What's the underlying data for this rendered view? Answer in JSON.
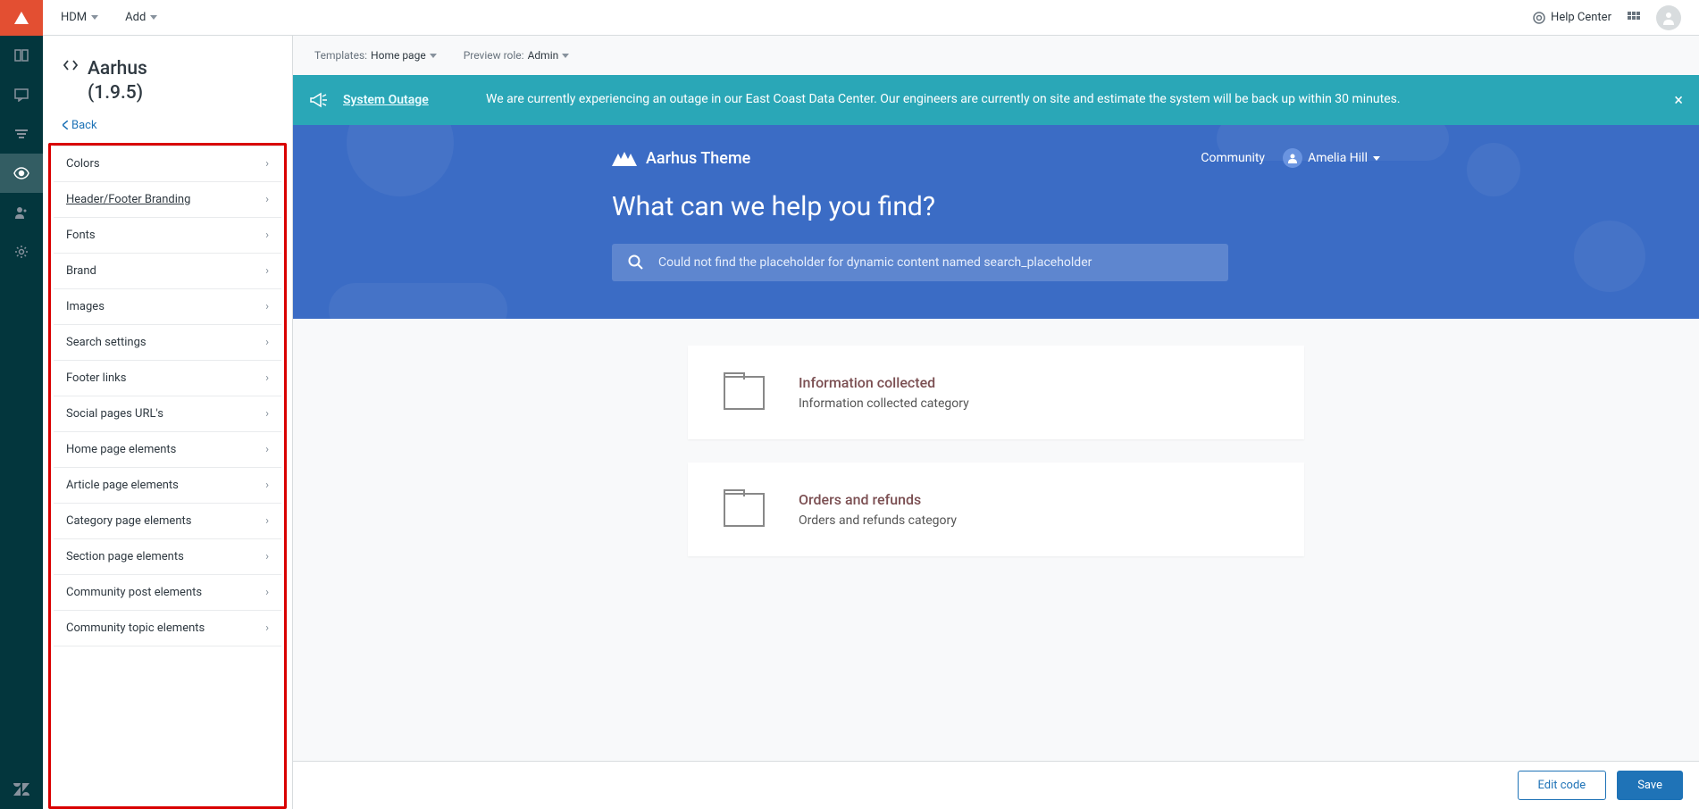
{
  "topbar": {
    "dropdowns": [
      "HDM",
      "Add"
    ],
    "help_center": "Help Center"
  },
  "sidebar": {
    "title": "Aarhus",
    "version": "(1.9.5)",
    "back": "Back",
    "items": [
      "Colors",
      "Header/Footer Branding",
      "Fonts",
      "Brand",
      "Images",
      "Search settings",
      "Footer links",
      "Social pages URL's",
      "Home page elements",
      "Article page elements",
      "Category page elements",
      "Section page elements",
      "Community post elements",
      "Community topic elements"
    ]
  },
  "crumbs": {
    "templates_label": "Templates:",
    "templates_value": "Home page",
    "role_label": "Preview role:",
    "role_value": "Admin"
  },
  "alert": {
    "title": "System Outage",
    "text": "We are currently experiencing an outage in our East Coast Data Center. Our engineers are currently on site and estimate the system will be back up within 30 minutes."
  },
  "hero": {
    "brand": "Aarhus Theme",
    "community": "Community",
    "user": "Amelia Hill",
    "title": "What can we help you find?",
    "search_placeholder": "Could not find the placeholder for dynamic content named search_placeholder"
  },
  "cards": [
    {
      "title": "Information collected",
      "sub": "Information collected category"
    },
    {
      "title": "Orders and refunds",
      "sub": "Orders and refunds category"
    }
  ],
  "actions": {
    "edit": "Edit code",
    "save": "Save"
  }
}
